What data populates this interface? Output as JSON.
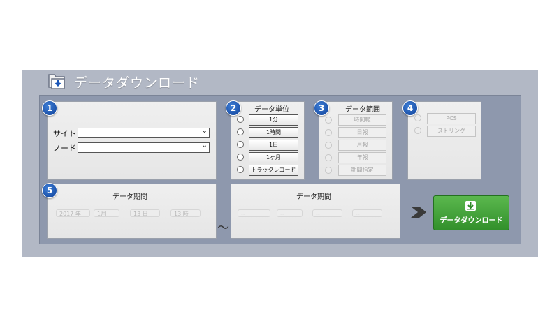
{
  "header": {
    "title": "データダウンロード",
    "icon": "download-folder-icon"
  },
  "panel1": {
    "badge": "1",
    "site_label": "サイト",
    "node_label": "ノード",
    "site_value": "",
    "node_value": ""
  },
  "panel2": {
    "badge": "2",
    "title": "データ単位",
    "options": [
      "1分",
      "1時間",
      "1日",
      "1ヶ月",
      "トラックレコード"
    ]
  },
  "panel3": {
    "badge": "3",
    "title": "データ範囲",
    "options": [
      "時間範",
      "日報",
      "月報",
      "年報",
      "期間指定"
    ]
  },
  "panel4": {
    "badge": "4",
    "options": [
      "PCS",
      "ストリング"
    ]
  },
  "panel5": {
    "badge": "5",
    "start": {
      "title": "データ期間",
      "year": "2017 年",
      "month": "1月",
      "day": "13 日",
      "hour": "13 時"
    },
    "separator": "～",
    "end": {
      "title": "データ期間",
      "year": "--",
      "month": "--",
      "day": "--",
      "hour": "--"
    }
  },
  "download": {
    "label": "データダウンロード"
  },
  "colors": {
    "accent_green": "#3a9a32",
    "badge_blue": "#1a56b8",
    "frame": "#b2b8c5",
    "inner": "#8e98ad"
  }
}
